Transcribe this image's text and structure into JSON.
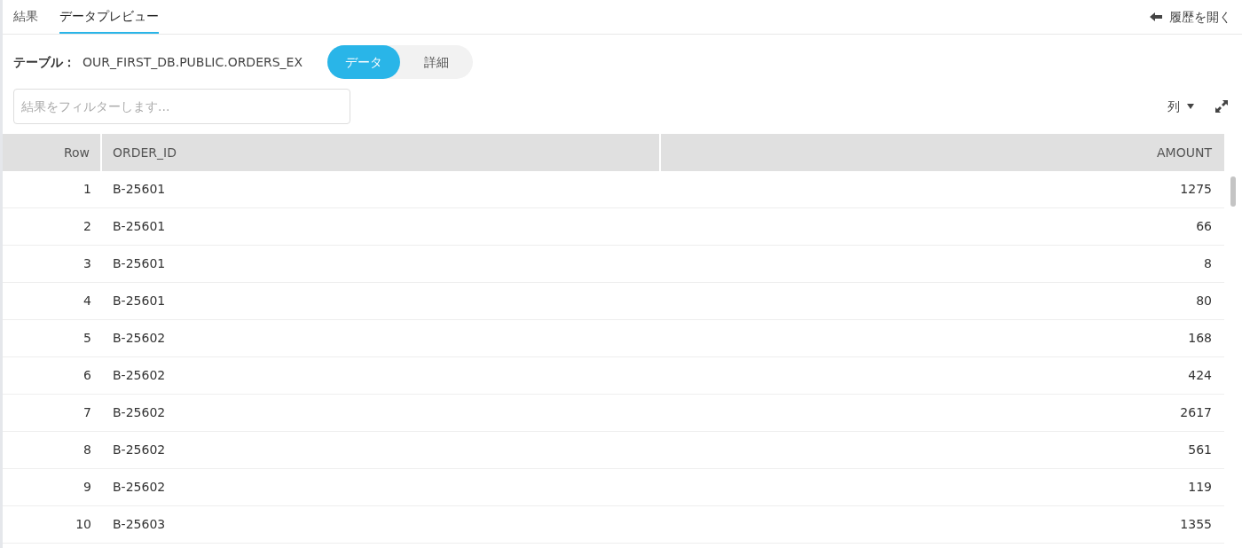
{
  "tabs": [
    {
      "label": "結果",
      "selected": false
    },
    {
      "label": "データプレビュー",
      "selected": true
    }
  ],
  "history_button": {
    "label": "履歴を開く"
  },
  "table_label": {
    "label": "テーブル：",
    "name": "OUR_FIRST_DB.PUBLIC.ORDERS_EX"
  },
  "view_toggle": [
    {
      "label": "データ",
      "selected": true
    },
    {
      "label": "詳細",
      "selected": false
    }
  ],
  "filter": {
    "placeholder": "結果をフィルターします..."
  },
  "columns_button": {
    "label": "列"
  },
  "table": {
    "columns": [
      "Row",
      "ORDER_ID",
      "AMOUNT"
    ],
    "rows": [
      [
        "1",
        "B-25601",
        "1275"
      ],
      [
        "2",
        "B-25601",
        "66"
      ],
      [
        "3",
        "B-25601",
        "8"
      ],
      [
        "4",
        "B-25601",
        "80"
      ],
      [
        "5",
        "B-25602",
        "168"
      ],
      [
        "6",
        "B-25602",
        "424"
      ],
      [
        "7",
        "B-25602",
        "2617"
      ],
      [
        "8",
        "B-25602",
        "561"
      ],
      [
        "9",
        "B-25602",
        "119"
      ],
      [
        "10",
        "B-25603",
        "1355"
      ]
    ]
  }
}
